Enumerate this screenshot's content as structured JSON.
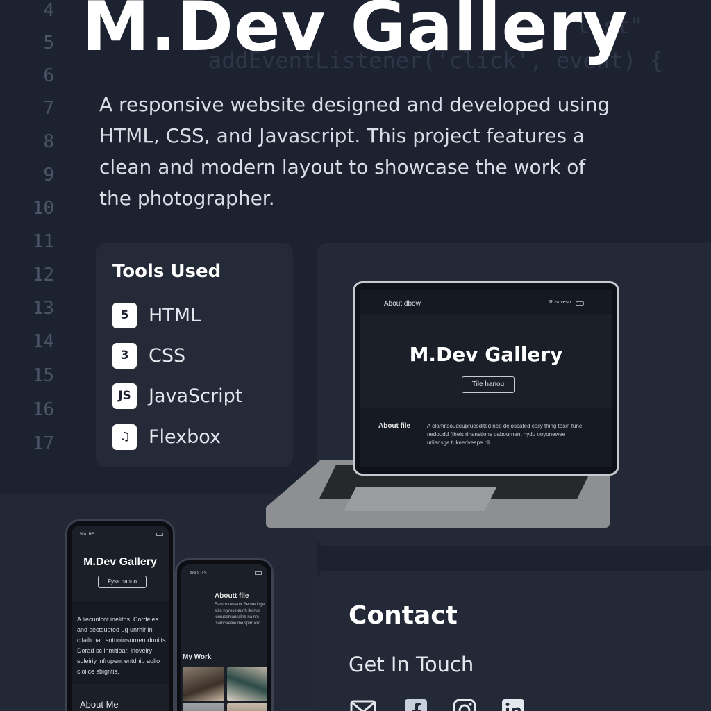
{
  "editor": {
    "line_numbers": [
      "4",
      "5",
      "6",
      "7",
      "8",
      "9",
      "10",
      "11",
      "12",
      "13",
      "14",
      "15",
      "16",
      "17"
    ],
    "code_snippets": [
      "list\"",
      "addEventListener('click', event) {"
    ]
  },
  "hero": {
    "title": "M.Dev Gallery",
    "description": "A responsive website designed and developed using HTML, CSS, and Javascript. This project features a clean and modern layout to showcase the work of the photographer."
  },
  "tools": {
    "title": "Tools Used",
    "items": [
      {
        "label": "HTML",
        "icon": "html5-icon",
        "glyph": "5"
      },
      {
        "label": "CSS",
        "icon": "css3-icon",
        "glyph": "3"
      },
      {
        "label": "JavaScript",
        "icon": "js-icon",
        "glyph": "JS"
      },
      {
        "label": "Flexbox",
        "icon": "music-note-icon",
        "glyph": "♫"
      }
    ]
  },
  "laptop_preview": {
    "nav_title": "About dbow",
    "nav_right": "Rosuveso",
    "hero_title": "M.Dev Gallery",
    "button_label": "Tile hanou",
    "about_title": "About file",
    "about_text": "A elamitsoudeuprucedited  neo dejoscated coily thing tosin fune nedoudd (theis rinanstions oabournent hydu ooyonewee urliansge tuknedveape rili"
  },
  "phone1": {
    "status": "WALRS",
    "title": "M.Dev Gallery",
    "button_label": "Fyse hanuo",
    "text": "A liecunlcot ineliths, Cordeles and sectsupted ug unrhir in cifaih han sotnoirrsornerodnoilts Dorad sc inmitioar, inoveiry soleiriy infrupent entdnip aolio cloiice sbigntis,",
    "about_title": "About Me"
  },
  "phone2": {
    "status": "ABOUTS",
    "about_title": "Aboutt flle",
    "about_text": "Earnrrouesantr Seinre inge stiin niyreceteunh ilerrulo luorusemansdina na nrs tsamrsrelne mo spirrucro",
    "my_work": "My Work"
  },
  "contact": {
    "title": "Contact",
    "subtitle": "Get In Touch",
    "social_icons": [
      "email-icon",
      "facebook-icon",
      "instagram-icon",
      "linkedin-icon"
    ]
  },
  "colors": {
    "background": "#1d2230",
    "panel": "#242a37",
    "text": "#e8ebf0",
    "accent_white": "#ffffff"
  }
}
